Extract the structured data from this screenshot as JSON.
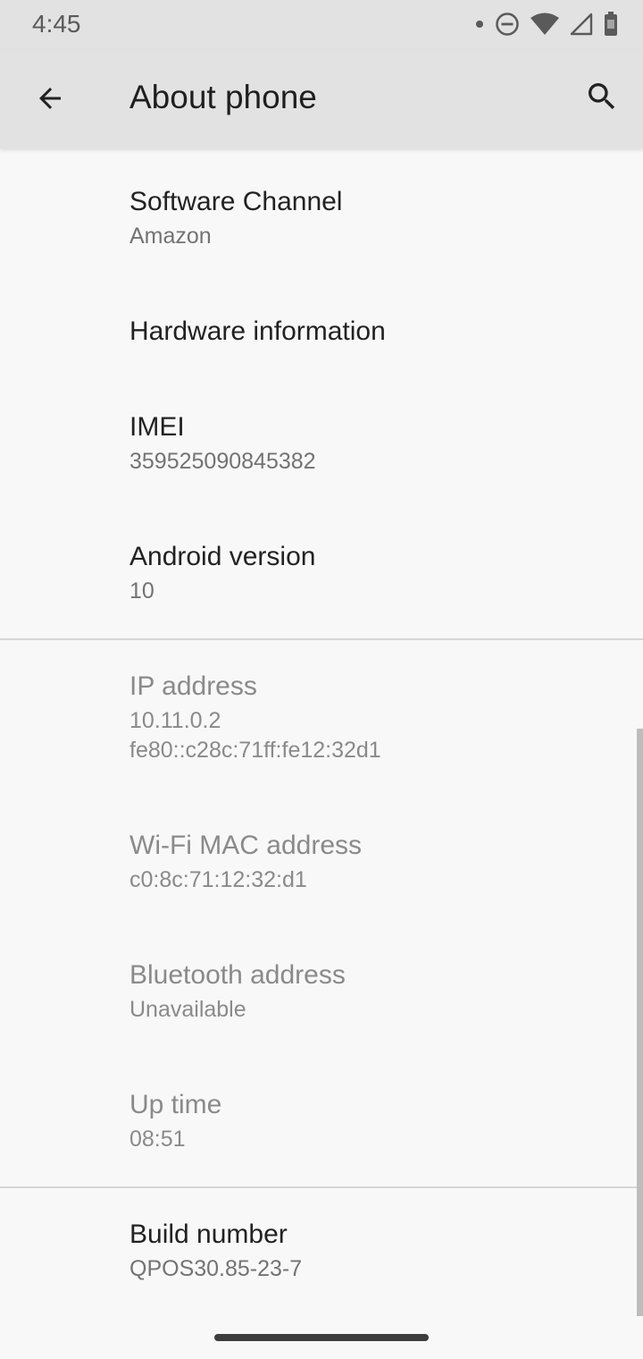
{
  "status_bar": {
    "time": "4:45",
    "icons": [
      "notification-dot-icon",
      "do-not-disturb-icon",
      "wifi-icon",
      "cell-signal-icon",
      "battery-icon"
    ]
  },
  "app_bar": {
    "back_icon": "arrow-back-icon",
    "title": "About phone",
    "search_icon": "search-icon"
  },
  "items": [
    {
      "title": "Software Channel",
      "subtitle": "Amazon"
    },
    {
      "title": "Hardware information"
    },
    {
      "title": "IMEI",
      "subtitle": "359525090845382"
    },
    {
      "title": "Android version",
      "subtitle": "10"
    },
    {
      "title": "IP address",
      "subtitle": "10.11.0.2",
      "subtitle2": "fe80::c28c:71ff:fe12:32d1"
    },
    {
      "title": "Wi-Fi MAC address",
      "subtitle": "c0:8c:71:12:32:d1"
    },
    {
      "title": "Bluetooth address",
      "subtitle": "Unavailable"
    },
    {
      "title": "Up time",
      "subtitle": "08:51"
    },
    {
      "title": "Build number",
      "subtitle": "QPOS30.85-23-7"
    }
  ],
  "colors": {
    "app_bar_bg": "#e2e2e2",
    "page_bg": "#f8f8f8",
    "primary_text": "#222222",
    "secondary_text": "#737373"
  }
}
